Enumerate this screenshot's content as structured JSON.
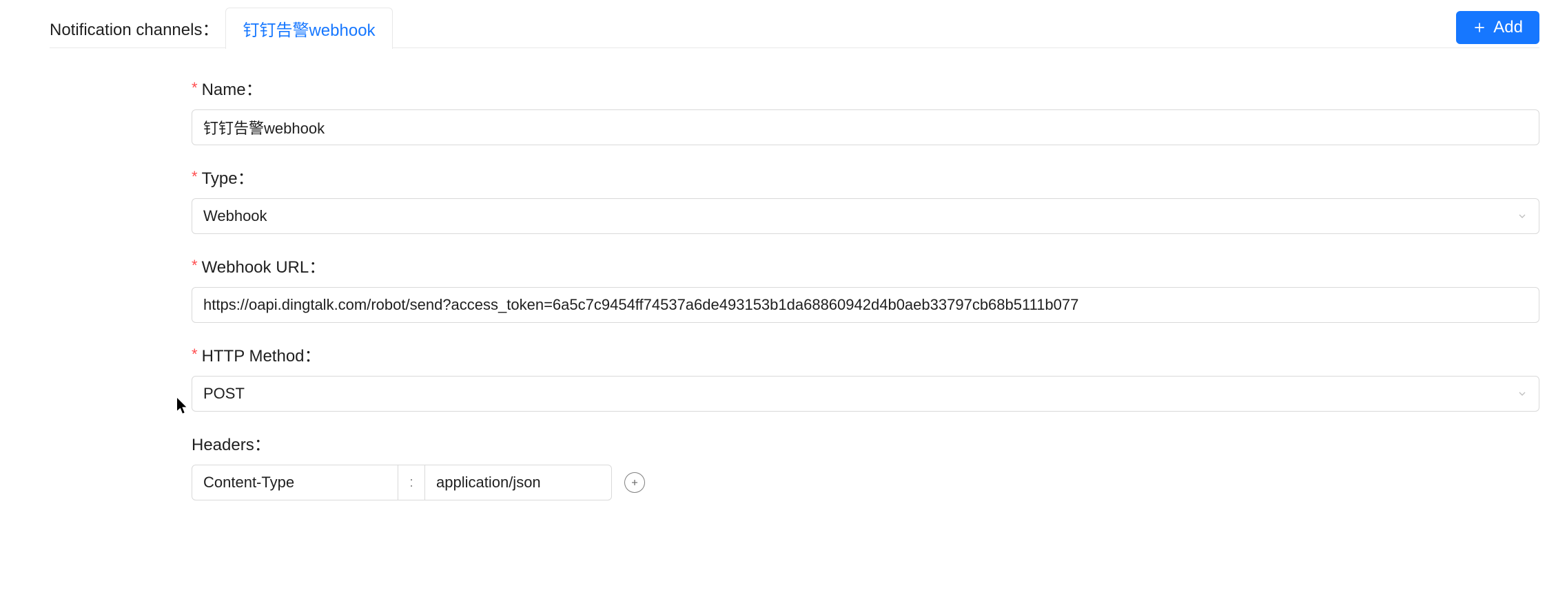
{
  "header": {
    "section_label": "Notification channels：",
    "tab_label": "钉钉告警webhook",
    "add_button_label": "Add"
  },
  "form": {
    "name": {
      "label": "Name：",
      "required": true,
      "value": "钉钉告警webhook"
    },
    "type": {
      "label": "Type：",
      "required": true,
      "value": "Webhook"
    },
    "webhook_url": {
      "label": "Webhook URL：",
      "required": true,
      "value": "https://oapi.dingtalk.com/robot/send?access_token=6a5c7c9454ff74537a6de493153b1da68860942d4b0aeb33797cb68b5111b077"
    },
    "http_method": {
      "label": "HTTP Method：",
      "required": true,
      "value": "POST"
    },
    "headers": {
      "label": "Headers：",
      "required": false,
      "rows": [
        {
          "key": "Content-Type",
          "sep": ":",
          "value": "application/json"
        }
      ]
    }
  }
}
